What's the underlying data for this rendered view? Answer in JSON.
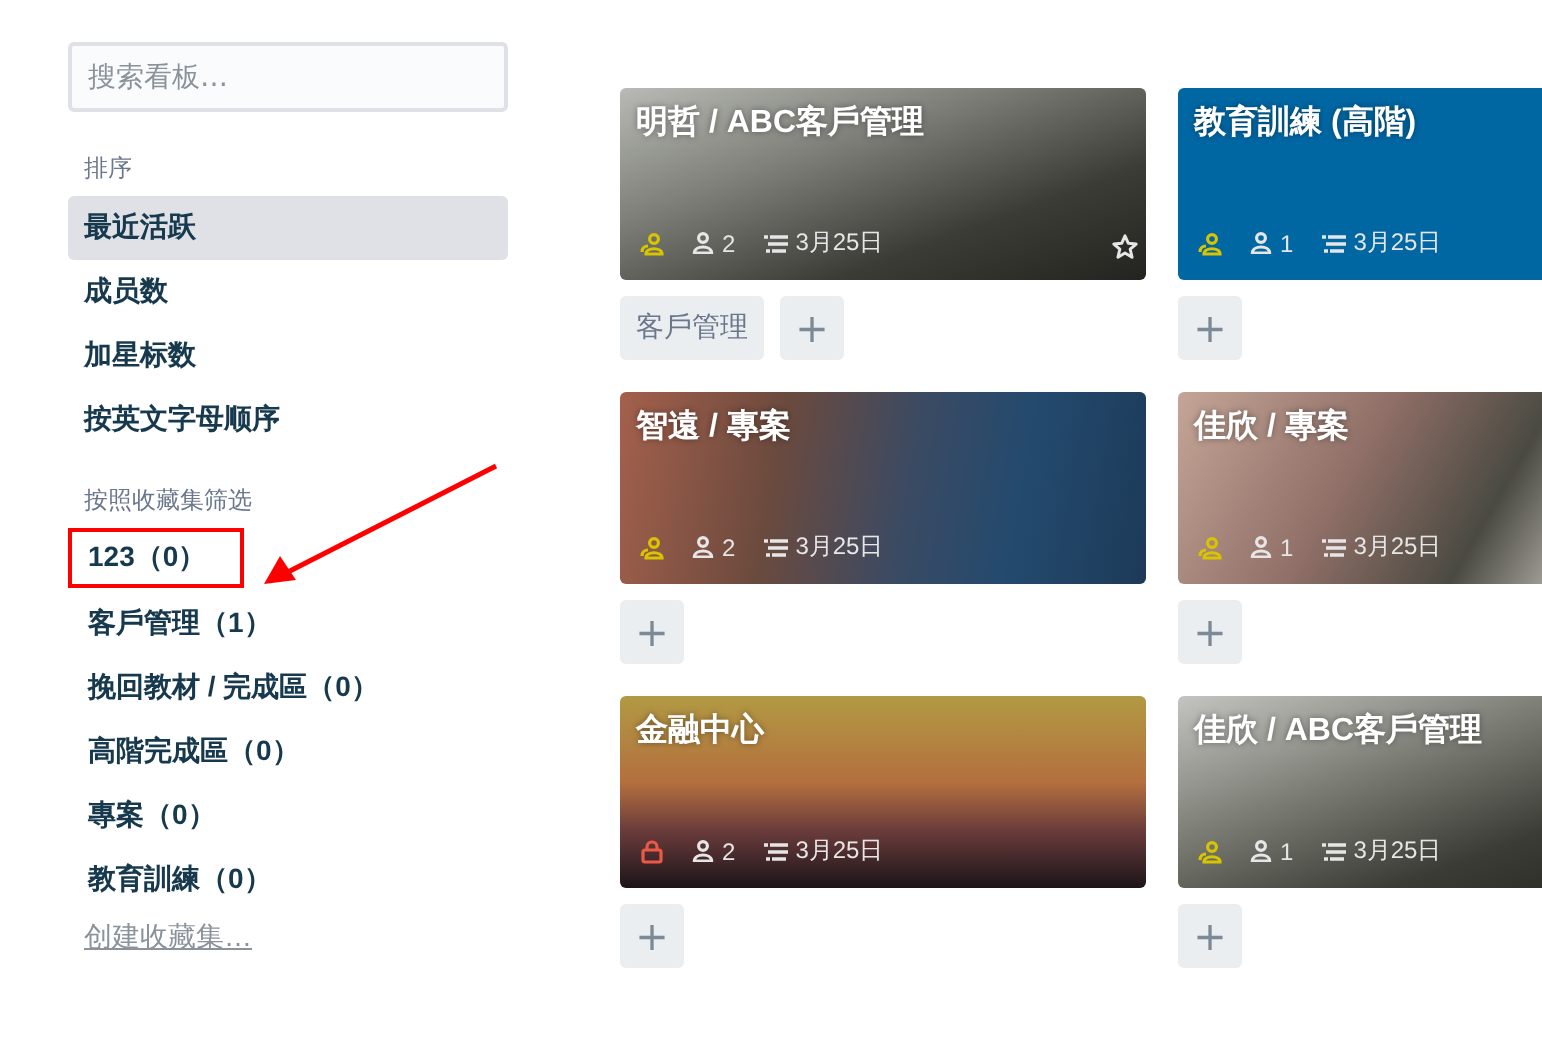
{
  "sidebar": {
    "search": {
      "placeholder": "搜索看板…"
    },
    "sort_heading": "排序",
    "sort_items": [
      {
        "label": "最近活跃",
        "selected": true
      },
      {
        "label": "成员数",
        "selected": false
      },
      {
        "label": "加星标数",
        "selected": false
      },
      {
        "label": "按英文字母顺序",
        "selected": false
      }
    ],
    "filter_heading": "按照收藏集筛选",
    "collections": [
      {
        "label": "123（0）",
        "highlighted": true
      },
      {
        "label": "客戶管理（1）",
        "highlighted": false
      },
      {
        "label": "挽回教材 / 完成區（0）",
        "highlighted": false
      },
      {
        "label": "高階完成區（0）",
        "highlighted": false
      },
      {
        "label": "專案（0）",
        "highlighted": false
      },
      {
        "label": "教育訓練（0）",
        "highlighted": false
      }
    ],
    "create_link": "创建收藏集…"
  },
  "boards": [
    {
      "title": "明哲 / ABC客戶管理",
      "kind": "photo",
      "private": false,
      "members": "2",
      "date": "3月25日",
      "star_visible": true,
      "actions": [
        {
          "kind": "tag",
          "label": "客戶管理"
        },
        {
          "kind": "add",
          "label": "+"
        }
      ]
    },
    {
      "title": "教育訓練 (高階)",
      "kind": "solid",
      "color": "#0067a3",
      "private": false,
      "members": "1",
      "date": "3月25日",
      "star_visible": false,
      "actions": [
        {
          "kind": "add",
          "label": "+"
        }
      ]
    },
    {
      "title": "智遠 / 專案",
      "kind": "photo",
      "private": false,
      "members": "2",
      "date": "3月25日",
      "star_visible": false,
      "actions": [
        {
          "kind": "add",
          "label": "+"
        }
      ]
    },
    {
      "title": "佳欣 / 專案",
      "kind": "photo",
      "private": false,
      "members": "1",
      "date": "3月25日",
      "star_visible": false,
      "actions": [
        {
          "kind": "add",
          "label": "+"
        }
      ]
    },
    {
      "title": "金融中心",
      "kind": "photo",
      "private": true,
      "members": "2",
      "date": "3月25日",
      "star_visible": false,
      "actions": [
        {
          "kind": "add",
          "label": "+"
        }
      ]
    },
    {
      "title": "佳欣 / ABC客戶管理",
      "kind": "photo",
      "private": false,
      "members": "1",
      "date": "3月25日",
      "star_visible": false,
      "actions": [
        {
          "kind": "add",
          "label": "+"
        }
      ]
    }
  ]
}
